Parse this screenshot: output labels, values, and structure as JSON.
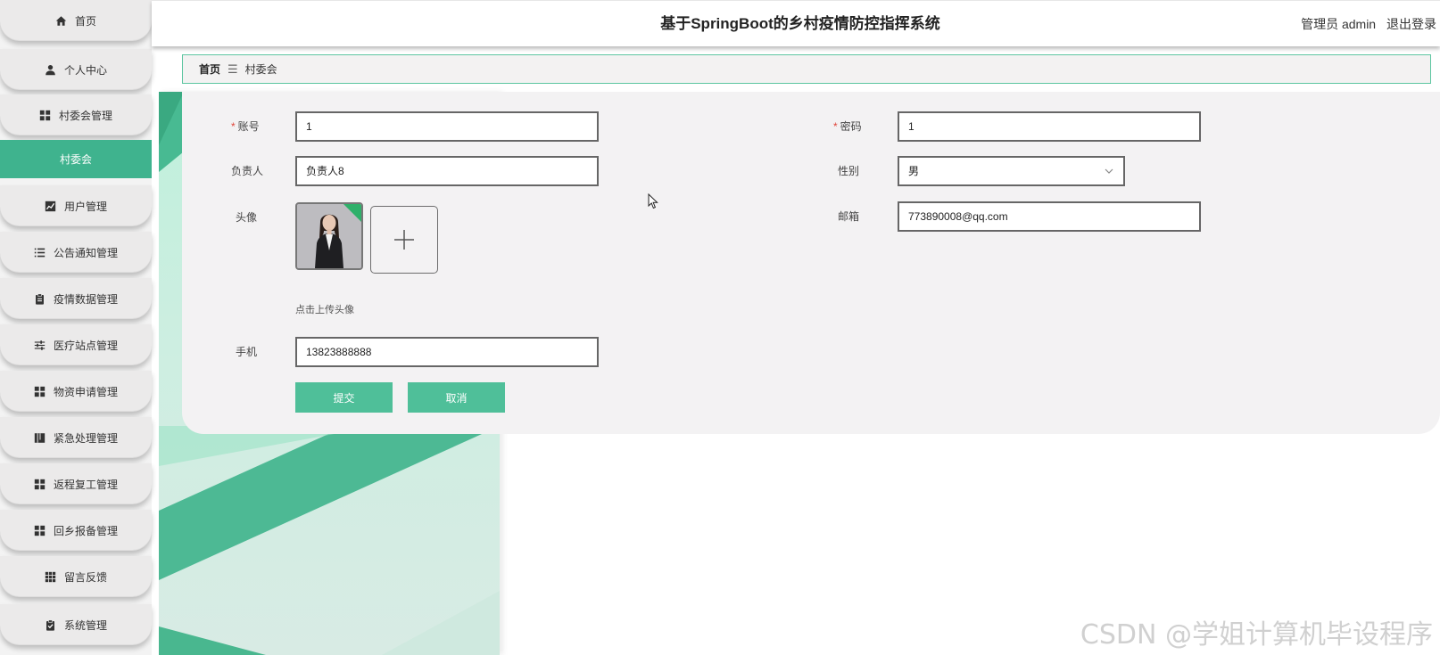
{
  "app": {
    "title": "基于SpringBoot的乡村疫情防控指挥系统",
    "user": "管理员 admin",
    "logout": "退出登录"
  },
  "sidebar": {
    "items": [
      {
        "label": "首页",
        "icon": "home-icon"
      },
      {
        "label": "个人中心",
        "icon": "user-icon"
      },
      {
        "label": "村委会管理",
        "icon": "grid-icon"
      },
      {
        "label": "用户管理",
        "icon": "chart-icon"
      },
      {
        "label": "公告通知管理",
        "icon": "list-icon"
      },
      {
        "label": "疫情数据管理",
        "icon": "clipboard-icon"
      },
      {
        "label": "医疗站点管理",
        "icon": "sliders-icon"
      },
      {
        "label": "物资申请管理",
        "icon": "grid-icon"
      },
      {
        "label": "紧急处理管理",
        "icon": "book-icon"
      },
      {
        "label": "返程复工管理",
        "icon": "grid-icon"
      },
      {
        "label": "回乡报备管理",
        "icon": "grid-icon"
      },
      {
        "label": "留言反馈",
        "icon": "apps-icon"
      },
      {
        "label": "系统管理",
        "icon": "clipboard-check-icon"
      }
    ],
    "active_submenu": "村委会"
  },
  "breadcrumb": {
    "home": "首页",
    "separator": "☰",
    "current": "村委会"
  },
  "form": {
    "account_label": "账号",
    "account_value": "1",
    "password_label": "密码",
    "password_value": "1",
    "manager_label": "负责人",
    "manager_value": "负责人8",
    "gender_label": "性别",
    "gender_value": "男",
    "avatar_label": "头像",
    "email_label": "邮箱",
    "email_value": "773890008@qq.com",
    "upload_hint": "点击上传头像",
    "phone_label": "手机",
    "phone_value": "13823888888",
    "submit_label": "提交",
    "cancel_label": "取消",
    "required_mark": "*"
  },
  "watermark": "CSDN @学姐计算机毕设程序",
  "colors": {
    "accent": "#3fb38e",
    "button": "#4fbf99",
    "breadcrumb_border": "#5cc5a0",
    "required": "#e0453a"
  }
}
